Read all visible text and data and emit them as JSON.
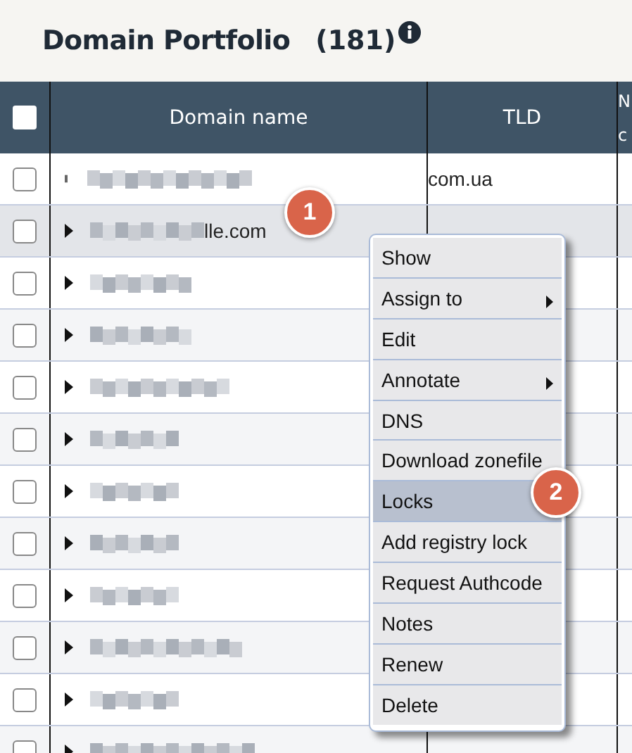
{
  "title": "Domain Portfolio",
  "count": "(181)",
  "header": {
    "select_all_checked": false,
    "columns": [
      "Domain name",
      "TLD"
    ],
    "column_3": [
      "N",
      "c"
    ]
  },
  "rows": [
    {
      "expandable": false,
      "checked": false,
      "selected": false,
      "visible_name": "",
      "tld": "com.ua"
    },
    {
      "expandable": true,
      "checked": false,
      "selected": true,
      "visible_name": "lle.com",
      "tld": ""
    },
    {
      "expandable": true,
      "checked": false,
      "selected": false,
      "visible_name": "",
      "tld": ""
    },
    {
      "expandable": true,
      "checked": false,
      "selected": false,
      "visible_name": "",
      "tld": ""
    },
    {
      "expandable": true,
      "checked": false,
      "selected": false,
      "visible_name": "",
      "tld": ""
    },
    {
      "expandable": true,
      "checked": false,
      "selected": false,
      "visible_name": "",
      "tld": ""
    },
    {
      "expandable": true,
      "checked": false,
      "selected": false,
      "visible_name": "",
      "tld": ""
    },
    {
      "expandable": true,
      "checked": false,
      "selected": false,
      "visible_name": "",
      "tld": ""
    },
    {
      "expandable": true,
      "checked": false,
      "selected": false,
      "visible_name": "",
      "tld": ""
    },
    {
      "expandable": true,
      "checked": false,
      "selected": false,
      "visible_name": "",
      "tld": ""
    },
    {
      "expandable": true,
      "checked": false,
      "selected": false,
      "visible_name": "",
      "tld": ""
    },
    {
      "expandable": true,
      "checked": false,
      "selected": false,
      "visible_name": "",
      "tld": ""
    }
  ],
  "context_menu": [
    {
      "label": "Show",
      "submenu": false,
      "selected": false
    },
    {
      "label": "Assign to",
      "submenu": true,
      "selected": false
    },
    {
      "label": "Edit",
      "submenu": false,
      "selected": false
    },
    {
      "label": "Annotate",
      "submenu": true,
      "selected": false
    },
    {
      "label": "DNS",
      "submenu": false,
      "selected": false
    },
    {
      "label": "Download zonefile",
      "submenu": false,
      "selected": false
    },
    {
      "label": "Locks",
      "submenu": false,
      "selected": true
    },
    {
      "label": "Add registry lock",
      "submenu": false,
      "selected": false
    },
    {
      "label": "Request Authcode",
      "submenu": false,
      "selected": false
    },
    {
      "label": "Notes",
      "submenu": false,
      "selected": false
    },
    {
      "label": "Renew",
      "submenu": false,
      "selected": false
    },
    {
      "label": "Delete",
      "submenu": false,
      "selected": false
    }
  ],
  "callouts": [
    "1",
    "2"
  ]
}
